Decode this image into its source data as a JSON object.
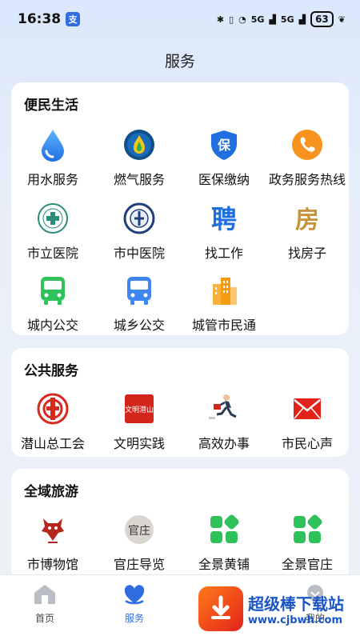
{
  "status_bar": {
    "time": "16:38",
    "app_badge": "支",
    "network_1": "5G",
    "network_2": "5G",
    "battery": "63"
  },
  "page": {
    "title": "服务"
  },
  "sections": [
    {
      "title": "便民生活",
      "items": [
        {
          "label": "用水服务",
          "icon": "water-drop-icon"
        },
        {
          "label": "燃气服务",
          "icon": "gas-flame-icon"
        },
        {
          "label": "医保缴纳",
          "icon": "medical-insurance-shield-icon",
          "icon_text": "保"
        },
        {
          "label": "政务服务热线",
          "icon": "phone-hotline-icon"
        },
        {
          "label": "市立医院",
          "icon": "city-hospital-logo-icon"
        },
        {
          "label": "市中医院",
          "icon": "tcm-hospital-logo-icon"
        },
        {
          "label": "找工作",
          "icon": "job-hiring-icon",
          "icon_text": "聘"
        },
        {
          "label": "找房子",
          "icon": "house-finding-icon",
          "icon_text": "房"
        },
        {
          "label": "城内公交",
          "icon": "city-bus-icon"
        },
        {
          "label": "城乡公交",
          "icon": "rural-bus-icon"
        },
        {
          "label": "城管市民通",
          "icon": "city-buildings-icon"
        }
      ]
    },
    {
      "title": "公共服务",
      "items": [
        {
          "label": "潜山总工会",
          "icon": "trade-union-logo-icon"
        },
        {
          "label": "文明实践",
          "icon": "civilization-practice-icon",
          "icon_text": "文明潜山"
        },
        {
          "label": "高效办事",
          "icon": "running-businessman-icon"
        },
        {
          "label": "市民心声",
          "icon": "mail-envelope-icon"
        }
      ]
    },
    {
      "title": "全域旅游",
      "items": [
        {
          "label": "市博物馆",
          "icon": "museum-logo-icon"
        },
        {
          "label": "官庄导览",
          "icon": "guanzhuang-guide-icon",
          "icon_text": "官庄"
        },
        {
          "label": "全景黄铺",
          "icon": "panorama-grid-icon"
        },
        {
          "label": "全景官庄",
          "icon": "panorama-grid-icon"
        }
      ]
    }
  ],
  "bottom_nav": [
    {
      "label": "首页",
      "icon": "home-icon",
      "active": false
    },
    {
      "label": "服务",
      "icon": "service-heart-icon",
      "active": true
    },
    {
      "label": "",
      "icon": "message-icon",
      "active": false
    },
    {
      "label": "我的",
      "icon": "profile-icon",
      "active": false
    }
  ],
  "watermark": {
    "title": "超级棒下载站",
    "url": "www.cjbwh.com"
  },
  "colors": {
    "accent": "#2f6de1",
    "green": "#2fc25b",
    "red": "#e2231a",
    "orange": "#f7931e"
  }
}
